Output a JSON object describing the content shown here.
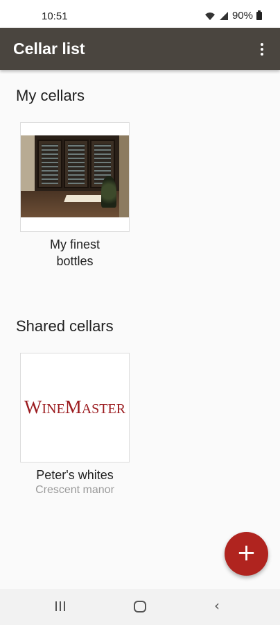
{
  "status_bar": {
    "time": "10:51",
    "battery": "90%",
    "icons": [
      "wifi-icon",
      "signal-icon",
      "battery-icon"
    ]
  },
  "app_bar": {
    "title": "Cellar list",
    "menu_icon": "overflow-menu-icon"
  },
  "my_cellars": {
    "heading": "My cellars",
    "items": [
      {
        "name": "My finest bottles",
        "image": "wine-cellar-photo"
      }
    ]
  },
  "shared_cellars": {
    "heading": "Shared cellars",
    "items": [
      {
        "name": "Peter's whites",
        "owner": "Crescent manor",
        "logo_text": "WineMaster"
      }
    ]
  },
  "fab": {
    "label": "+",
    "icon": "add-icon"
  },
  "nav": {
    "items": [
      "recent-apps-icon",
      "home-icon",
      "back-icon"
    ]
  },
  "colors": {
    "app_bar": "#4a453f",
    "fab": "#b0241f",
    "logo": "#9b1b1f"
  }
}
